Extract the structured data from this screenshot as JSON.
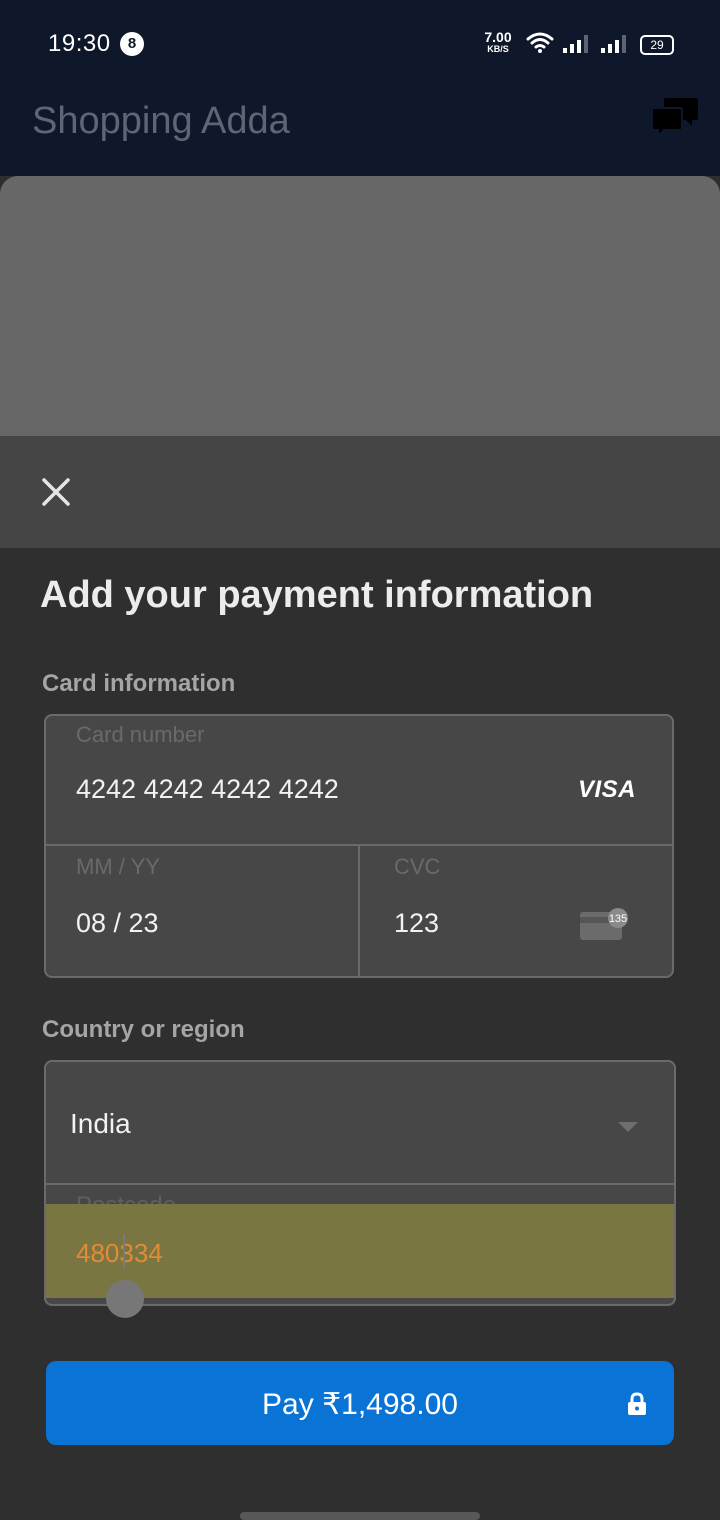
{
  "status_bar": {
    "time": "19:30",
    "notification_count": "8",
    "net_speed_value": "7.00",
    "net_speed_unit": "KB/S",
    "battery": "29"
  },
  "app": {
    "title": "Shopping Adda",
    "chat_icon": "chat-bubbles-icon"
  },
  "sheet": {
    "close_icon": "close-icon",
    "title": "Add your payment information",
    "card_section_label": "Card information",
    "card_number_label": "Card number",
    "card_number_value": "4242 4242 4242 4242",
    "card_brand": "VISA",
    "expiry_label": "MM / YY",
    "expiry_value": "08 / 23",
    "cvc_label": "CVC",
    "cvc_value": "123",
    "cvc_icon_text": "135",
    "country_section_label": "Country or region",
    "country_value": "India",
    "postcode_label": "Postcode",
    "postcode_value": "480334",
    "pay_label": "Pay ₹1,498.00"
  },
  "colors": {
    "status_bar": "#0f172a",
    "pay_button": "#0a74d6",
    "postcode_text": "#e48a35"
  }
}
